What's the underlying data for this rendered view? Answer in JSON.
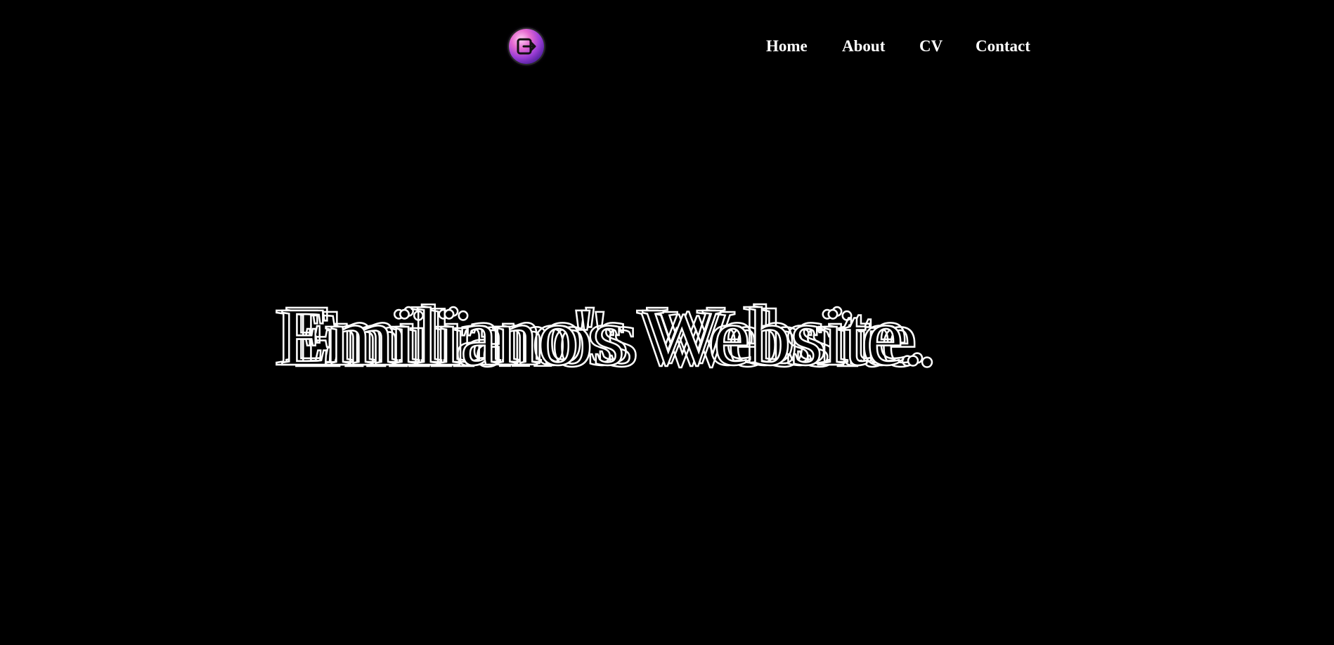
{
  "header": {
    "logo_icon": "app-logo-icon",
    "nav": [
      {
        "label": "Home"
      },
      {
        "label": "About"
      },
      {
        "label": "CV"
      },
      {
        "label": "Contact"
      }
    ]
  },
  "hero": {
    "title": "Emiliano's Website."
  },
  "colors": {
    "background": "#000000",
    "text": "#ffffff",
    "logo_accent": "#e56ad0"
  }
}
